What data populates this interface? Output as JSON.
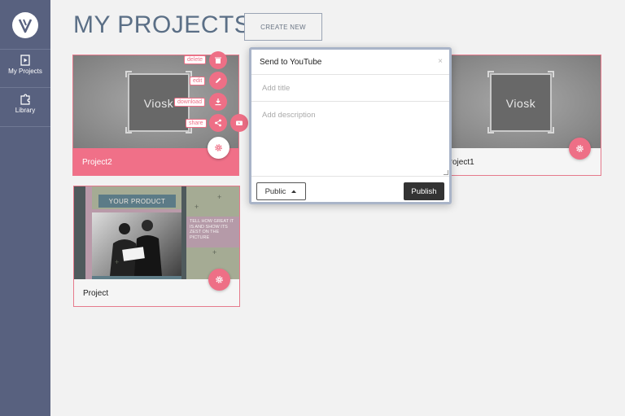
{
  "sidebar": {
    "items": [
      {
        "label": "My Projects",
        "icon": "play-file-icon"
      },
      {
        "label": "Library",
        "icon": "puzzle-icon"
      }
    ]
  },
  "header": {
    "title": "MY PROJECTS",
    "create_label": "CREATE NEW"
  },
  "projects": [
    {
      "name": "Project2",
      "thumbnail_text": "Viosk"
    },
    {
      "name": "Project1",
      "thumbnail_text": "Viosk"
    },
    {
      "name": "Project",
      "thumbnail_title": "YOUR PRODUCT",
      "thumbnail_body": "TELL HOW GREAT IT IS AND SHOW ITS ZEST ON THE PICTURE"
    }
  ],
  "actions": {
    "delete": "delete",
    "edit": "edit",
    "download": "download",
    "share": "share"
  },
  "modal": {
    "title": "Send to YouTube",
    "close": "×",
    "title_placeholder": "Add title",
    "description_placeholder": "Add description",
    "privacy": "Public",
    "publish": "Publish"
  },
  "colors": {
    "accent": "#ee6f86",
    "sidebar": "#58617f",
    "title": "#5b6f86"
  }
}
